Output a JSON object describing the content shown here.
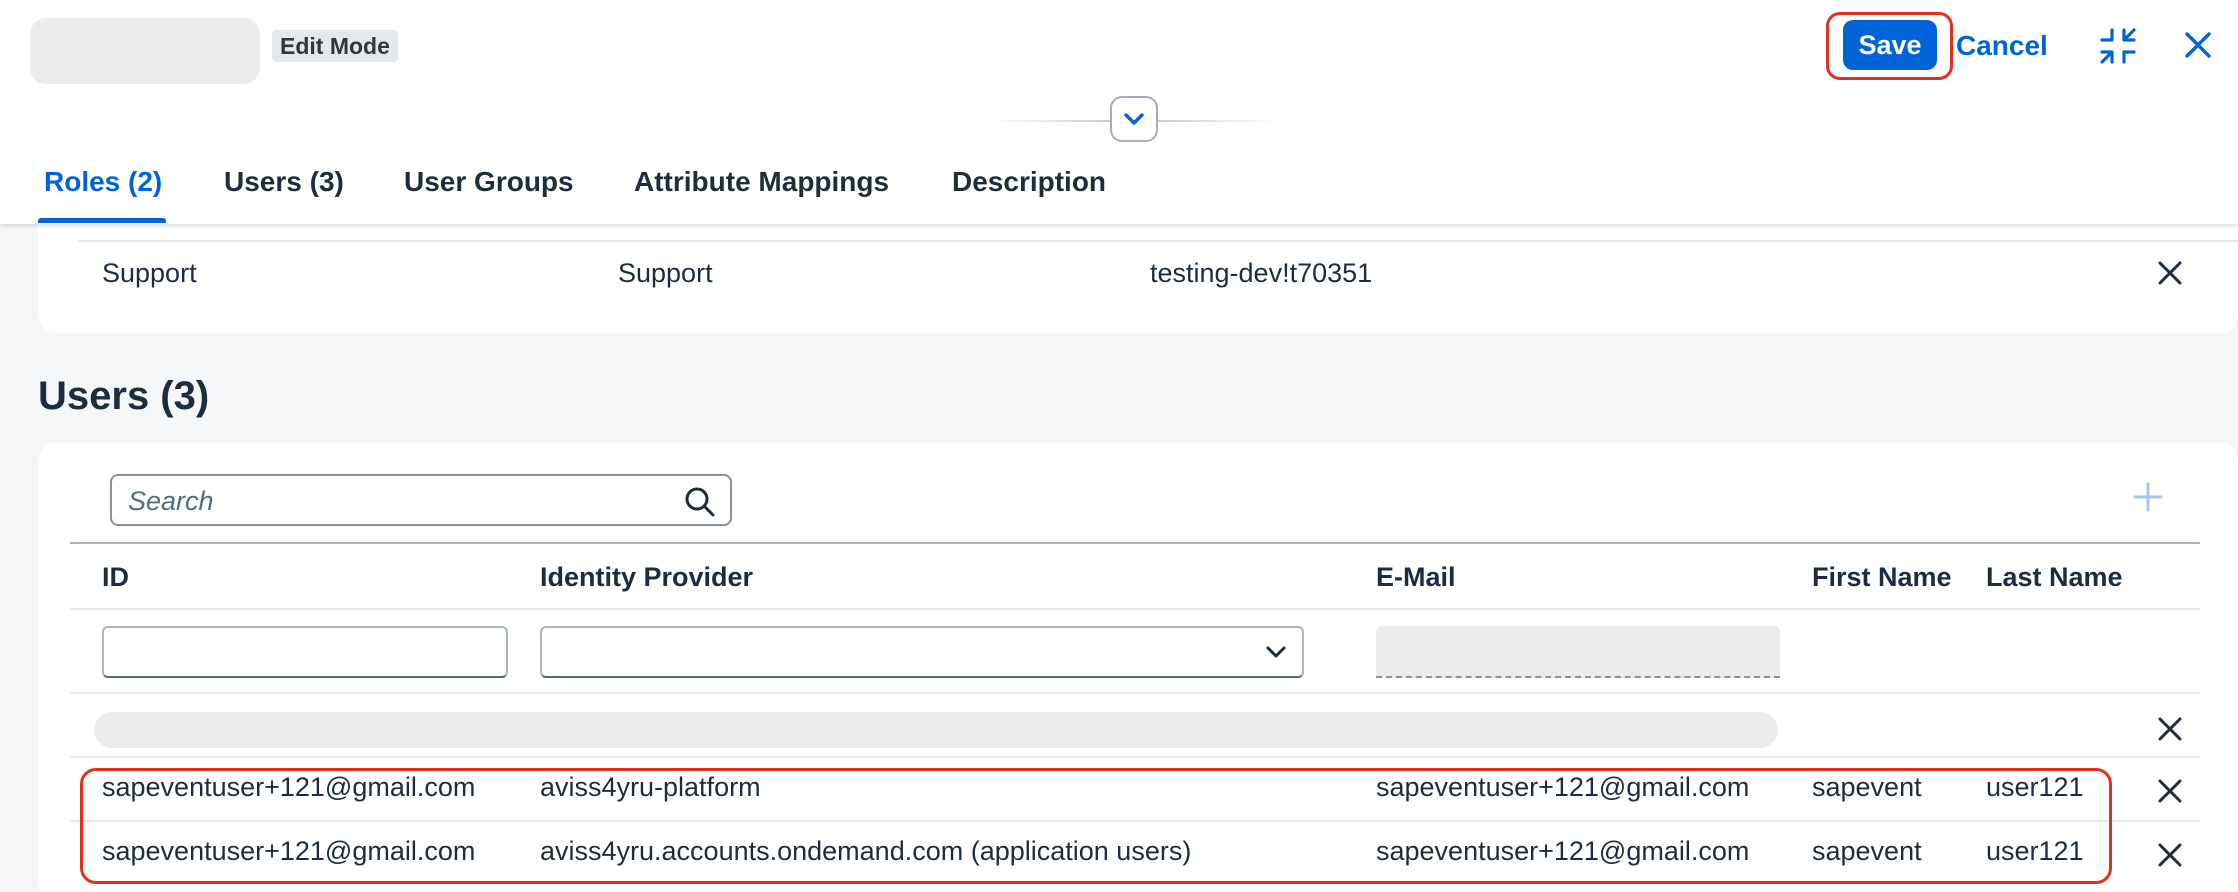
{
  "header": {
    "edit_badge": "Edit Mode",
    "save_label": "Save",
    "cancel_label": "Cancel",
    "exit_fullscreen_icon": "exit-fullscreen-icon",
    "close_icon": "close-icon",
    "collapse_icon": "chevron-down-icon"
  },
  "tabs": [
    {
      "label": "Roles (2)",
      "selected": true
    },
    {
      "label": "Users (3)"
    },
    {
      "label": "User Groups"
    },
    {
      "label": "Attribute Mappings"
    },
    {
      "label": "Description"
    }
  ],
  "roles": {
    "rows": [
      {
        "name": "Support",
        "template": "Support",
        "app": "testing-dev!t70351"
      }
    ]
  },
  "users": {
    "title": "Users (3)",
    "search_placeholder": "Search",
    "columns": [
      "ID",
      "Identity Provider",
      "E-Mail",
      "First Name",
      "Last Name"
    ],
    "rows": [
      {
        "id": "sapeventuser+121@gmail.com",
        "idp": "aviss4yru-platform",
        "email": "sapeventuser+121@gmail.com",
        "first": "sapevent",
        "last": "user121"
      },
      {
        "id": "sapeventuser+121@gmail.com",
        "idp": "aviss4yru.accounts.ondemand.com (application users)",
        "email": "sapeventuser+121@gmail.com",
        "first": "sapevent",
        "last": "user121"
      }
    ]
  },
  "colors": {
    "accent": "#0064d9",
    "highlight": "#e0301e"
  }
}
